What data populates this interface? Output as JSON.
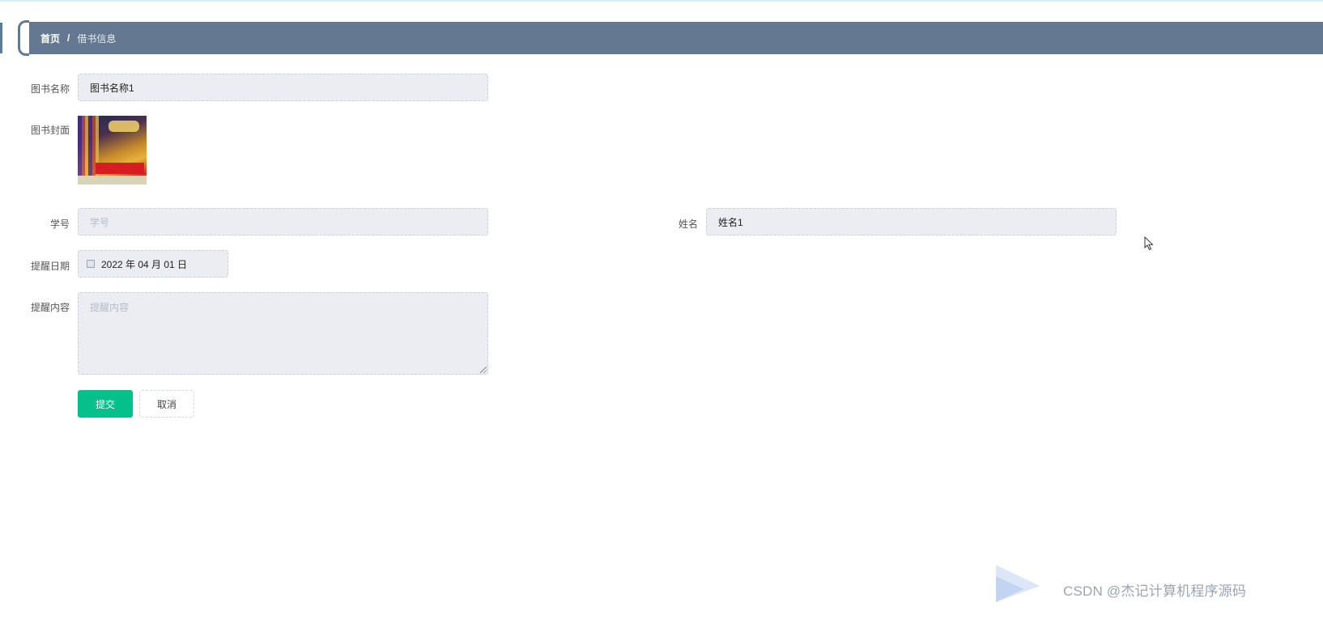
{
  "breadcrumb": {
    "home": "首页",
    "separator": "/",
    "current": "借书信息"
  },
  "form": {
    "book_name": {
      "label": "图书名称",
      "value": "图书名称1"
    },
    "book_cover": {
      "label": "图书封面"
    },
    "student_id": {
      "label": "学号",
      "placeholder": "学号"
    },
    "name": {
      "label": "姓名",
      "value": "姓名1"
    },
    "remind_date": {
      "label": "提醒日期",
      "value": "2022 年 04 月 01 日"
    },
    "remind_content": {
      "label": "提醒内容",
      "placeholder": "提醒内容"
    }
  },
  "buttons": {
    "submit": "提交",
    "cancel": "取消"
  },
  "watermark": {
    "text": "CSDN @杰记计算机程序源码"
  },
  "colors": {
    "header": "#647991",
    "primary": "#06c08c",
    "input_bg": "#ebedf2"
  },
  "icons": {
    "date": "calendar-icon",
    "cursor": "mouse-pointer-icon"
  }
}
